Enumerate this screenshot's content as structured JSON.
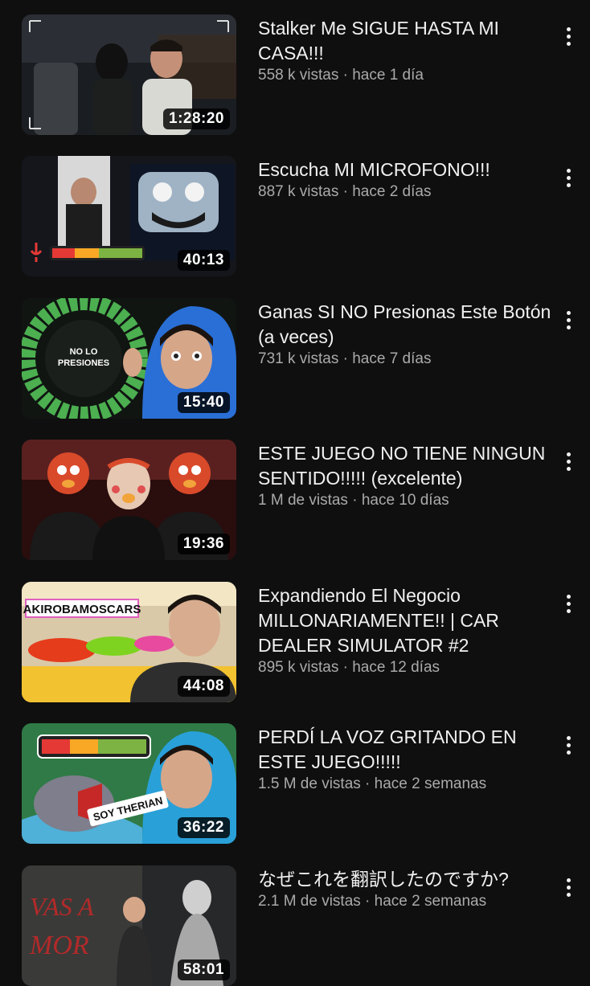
{
  "videos": [
    {
      "title": "Stalker Me SIGUE HASTA MI CASA!!!",
      "views": "558 k vistas",
      "age": "hace 1 día",
      "duration": "1:28:20"
    },
    {
      "title": "Escucha MI MICROFONO!!!",
      "views": "887 k vistas",
      "age": "hace 2 días",
      "duration": "40:13"
    },
    {
      "title": "Ganas SI NO Presionas Este Botón (a veces)",
      "views": "731 k vistas",
      "age": "hace 7 días",
      "duration": "15:40",
      "thumb_text": "NO LO PRESIONES"
    },
    {
      "title": "ESTE JUEGO NO TIENE NINGUN SENTIDO!!!!! (excelente)",
      "views": "1 M de vistas",
      "age": "hace 10 días",
      "duration": "19:36"
    },
    {
      "title": "Expandiendo El Negocio MILLONARIAMENTE!! | CAR DEALER SIMULATOR #2",
      "views": "895 k vistas",
      "age": "hace 12 días",
      "duration": "44:08",
      "thumb_text": "AKIROBAMOSCARS"
    },
    {
      "title": "PERDÍ LA VOZ GRITANDO EN ESTE JUEGO!!!!!",
      "views": "1.5 M de vistas",
      "age": "hace 2 semanas",
      "duration": "36:22",
      "thumb_text": "SOY THERIAN"
    },
    {
      "title": "なぜこれを翻訳したのですか?",
      "views": "2.1 M de vistas",
      "age": "hace 2 semanas",
      "duration": "58:01",
      "thumb_text": "VAS A MORIR"
    }
  ],
  "separator": " · ",
  "icons": {
    "menu": "more-vertical-icon"
  }
}
